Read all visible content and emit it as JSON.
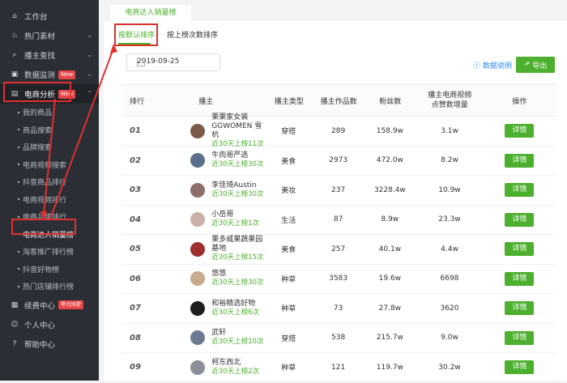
{
  "sidebar": {
    "items": [
      {
        "label": "工作台",
        "icon": "home-icon"
      },
      {
        "label": "热门素材",
        "icon": "fire-icon"
      },
      {
        "label": "播主查找",
        "icon": "search-icon"
      },
      {
        "label": "数据监测",
        "icon": "monitor-icon",
        "badge": "New"
      },
      {
        "label": "电商分析",
        "icon": "shop-icon",
        "badge": "New"
      }
    ],
    "sub_items": [
      "我的商品",
      "商品搜索",
      "品牌搜索",
      "电商视频搜索",
      "抖音商品排行",
      "电商视频排行",
      "电商品牌排行",
      "电商达人销量榜",
      "淘客推广排行榜",
      "抖音好物榜",
      "热门店铺排行榜"
    ],
    "bottom_items": [
      {
        "label": "续费中心",
        "icon": "cart-icon",
        "badge": "年付8折"
      },
      {
        "label": "个人中心",
        "icon": "user-icon"
      },
      {
        "label": "帮助中心",
        "icon": "help-icon"
      }
    ]
  },
  "main": {
    "tab": "电商达人销量榜",
    "subtabs": [
      "按默认排序",
      "按上榜次数排序"
    ],
    "date": "2019-09-25",
    "help": "数据说明",
    "export": "导出",
    "headers": [
      "排行",
      "播主",
      "播主类型",
      "播主作品数",
      "粉丝数",
      "播主电商视频\n点赞数增量",
      "操作"
    ],
    "rows": [
      {
        "rank": "01",
        "name": "栗栗家女装\nGGWOMEN 雪杭",
        "stat": "近30天上榜11次",
        "type": "穿搭",
        "works": "289",
        "fans": "158.9w",
        "likes": "3.1w",
        "action": "详情",
        "color": "#7c5a4a"
      },
      {
        "rank": "02",
        "name": "牛肉哥严选",
        "stat": "近30天上榜30次",
        "type": "美食",
        "works": "2973",
        "fans": "472.0w",
        "likes": "8.2w",
        "action": "详情",
        "color": "#5b6e8a"
      },
      {
        "rank": "03",
        "name": "李佳琦Austin",
        "stat": "近30天上榜30次",
        "type": "美妆",
        "works": "237",
        "fans": "3228.4w",
        "likes": "10.9w",
        "action": "详情",
        "color": "#8a6f6a"
      },
      {
        "rank": "04",
        "name": "小岳哥",
        "stat": "近30天上榜1次",
        "type": "生活",
        "works": "87",
        "fans": "8.9w",
        "likes": "23.3w",
        "action": "详情",
        "color": "#c9b1a7"
      },
      {
        "rank": "05",
        "name": "栗多威果蔬果园基地",
        "stat": "近30天上榜15次",
        "type": "美食",
        "works": "257",
        "fans": "40.1w",
        "likes": "4.4w",
        "action": "详情",
        "color": "#a03030"
      },
      {
        "rank": "06",
        "name": "悠悠",
        "stat": "近30天上榜30次",
        "type": "种草",
        "works": "3583",
        "fans": "19.6w",
        "likes": "6698",
        "action": "详情",
        "color": "#c7ab8e"
      },
      {
        "rank": "07",
        "name": "和裕精选好物",
        "stat": "近30天上榜6次",
        "type": "种草",
        "works": "73",
        "fans": "27.8w",
        "likes": "3620",
        "action": "详情",
        "color": "#1e1e1e"
      },
      {
        "rank": "08",
        "name": "武轩",
        "stat": "近30天上榜10次",
        "type": "穿搭",
        "works": "538",
        "fans": "215.7w",
        "likes": "9.0w",
        "action": "详情",
        "color": "#6b7a8f"
      },
      {
        "rank": "09",
        "name": "柯东西北",
        "stat": "近30天上榜2次",
        "type": "种草",
        "works": "121",
        "fans": "119.7w",
        "likes": "30.2w",
        "action": "详情",
        "color": "#8a8f9a"
      }
    ]
  }
}
